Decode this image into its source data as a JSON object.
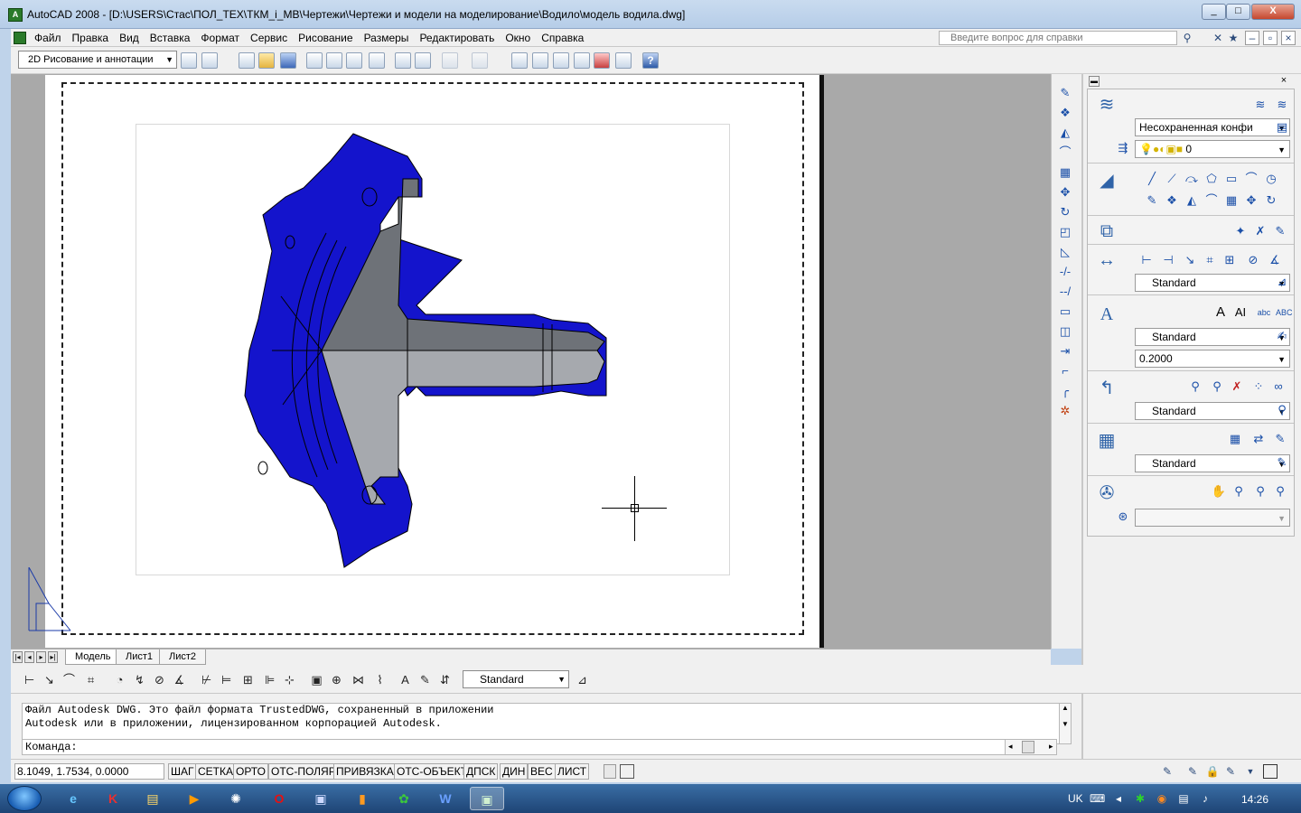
{
  "window": {
    "title": "AutoCAD 2008 - [D:\\USERS\\Стас\\ПОЛ_ТЕХ\\ТКМ_i_МВ\\Чертежи\\Чертежи и модели на моделирование\\Водило\\модель водила.dwg]",
    "app_icon": "A",
    "minimize": "_",
    "maximize": "□",
    "close": "X"
  },
  "menu": {
    "items": [
      "Файл",
      "Правка",
      "Вид",
      "Вставка",
      "Формат",
      "Сервис",
      "Рисование",
      "Размеры",
      "Редактировать",
      "Окно",
      "Справка"
    ],
    "help_placeholder": "Введите вопрос для справки"
  },
  "toolbar": {
    "workspace": "2D Рисование и аннотации"
  },
  "layouts": {
    "tabs": [
      "Модель",
      "Лист1",
      "Лист2"
    ],
    "active": "Модель"
  },
  "palette": {
    "layer_state": "Несохраненная конфи",
    "current_layer": "0",
    "dim_style": "Standard",
    "text_style": "Standard",
    "text_height": "0.2000",
    "mleader_style": "Standard",
    "table_style": "Standard",
    "text_icons": {
      "a1": "A",
      "a2": "AI",
      "abc1": "abc",
      "abc2": "ABC"
    }
  },
  "dim_toolbar": {
    "style": "Standard"
  },
  "command_line": {
    "history": [
      "Файл Autodesk DWG. Это файл формата TrustedDWG, сохраненный в приложении",
      "Autodesk или в приложении, лицензированном корпорацией Autodesk."
    ],
    "prompt": "Команда:"
  },
  "status_bar": {
    "coordinates": "8.1049,  1.7534, 0.0000",
    "toggles": [
      "ШАГ",
      "СЕТКА",
      "ОРТО",
      "ОТС-ПОЛЯР",
      "ПРИВЯЗКА",
      "ОТС-ОБЪЕКТ",
      "ДПСК",
      "ДИН",
      "ВЕС",
      "ЛИСТ"
    ]
  },
  "taskbar": {
    "language": "UK",
    "clock": "14:26"
  },
  "colors": {
    "model_blue": "#1414cc",
    "section_dark": "#6e7278",
    "section_light": "#a6a9ae"
  }
}
